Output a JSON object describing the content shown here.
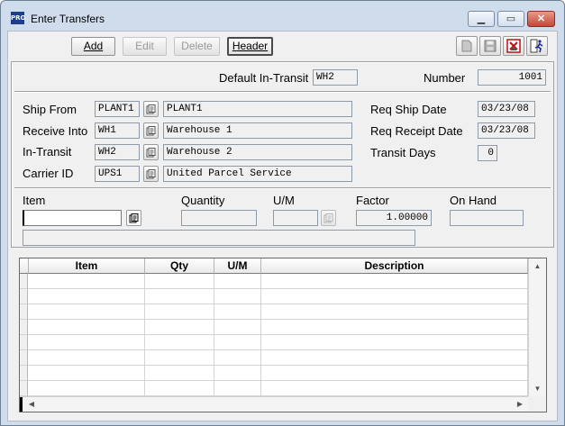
{
  "window": {
    "app_badge": "PRO",
    "title": "Enter Transfers",
    "minimize_glyph": "▁",
    "maximize_glyph": "▭",
    "close_glyph": "✕"
  },
  "toolbar": {
    "add_label": "Add",
    "edit_label": "Edit",
    "delete_label": "Delete",
    "header_label": "Header",
    "icons": [
      "new-doc-icon",
      "save-icon",
      "cancel-red-icon",
      "exit-icon"
    ]
  },
  "header": {
    "default_in_transit_label": "Default In-Transit",
    "default_in_transit_value": "WH2",
    "number_label": "Number",
    "number_value": "1001"
  },
  "details": {
    "ship_from_label": "Ship From",
    "ship_from_code": "PLANT1",
    "ship_from_desc": "PLANT1",
    "receive_into_label": "Receive Into",
    "receive_into_code": "WH1",
    "receive_into_desc": "Warehouse 1",
    "in_transit_label": "In-Transit",
    "in_transit_code": "WH2",
    "in_transit_desc": "Warehouse 2",
    "carrier_label": "Carrier ID",
    "carrier_code": "UPS1",
    "carrier_desc": "United Parcel Service",
    "req_ship_label": "Req Ship Date",
    "req_ship_value": "03/23/08",
    "req_receipt_label": "Req Receipt Date",
    "req_receipt_value": "03/23/08",
    "transit_days_label": "Transit Days",
    "transit_days_value": "0"
  },
  "line_entry": {
    "item_label": "Item",
    "item_value": "",
    "quantity_label": "Quantity",
    "quantity_value": "",
    "um_label": "U/M",
    "um_value": "",
    "factor_label": "Factor",
    "factor_value": "1.00000",
    "on_hand_label": "On Hand",
    "on_hand_value": "",
    "description_value": ""
  },
  "grid": {
    "columns": [
      "Item",
      "Qty",
      "U/M",
      "Description"
    ],
    "rows": [
      [
        "",
        "",
        "",
        ""
      ],
      [
        "",
        "",
        "",
        ""
      ],
      [
        "",
        "",
        "",
        ""
      ],
      [
        "",
        "",
        "",
        ""
      ],
      [
        "",
        "",
        "",
        ""
      ],
      [
        "",
        "",
        "",
        ""
      ],
      [
        "",
        "",
        "",
        ""
      ],
      [
        "",
        "",
        "",
        ""
      ]
    ],
    "scroll_up": "▲",
    "scroll_down": "▼",
    "scroll_left": "◀",
    "scroll_right": "▶"
  },
  "colors": {
    "window_frame": "#cfdcec",
    "client_bg": "#f0f0f0",
    "close_button": "#c24a38"
  }
}
